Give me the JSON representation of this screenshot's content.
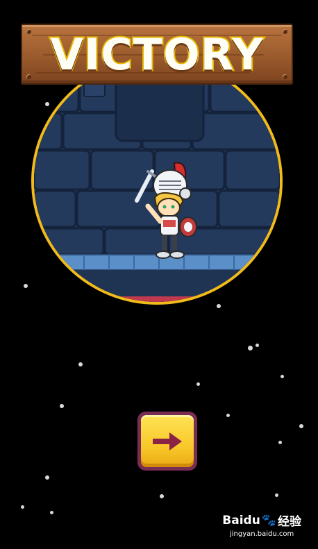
{
  "banner": {
    "title": "VICTORY"
  },
  "next_button": {
    "icon": "arrow-right-icon",
    "arrow_color": "#8a2346"
  },
  "watermark": {
    "brand": "Baidu",
    "product": "经验",
    "url": "jingyan.baidu.com"
  },
  "colors": {
    "background": "#000000",
    "banner_wood": "#9a5a2c",
    "title_outline": "#e6b800",
    "scene_ring": "#f2bb1a",
    "button_fill": "#f8c92a",
    "button_border": "#7a2d52"
  }
}
